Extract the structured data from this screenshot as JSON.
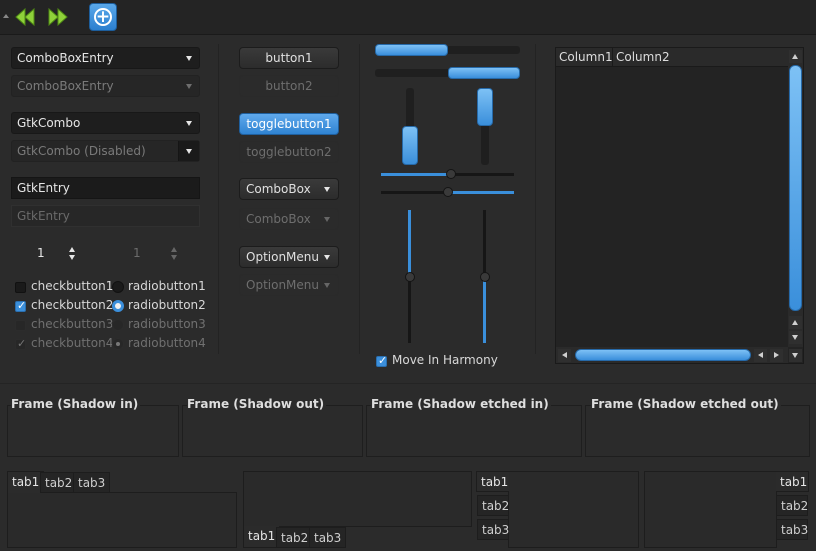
{
  "toolbar": {
    "icons": [
      "go-first-icon",
      "go-last-icon",
      "add-icon"
    ],
    "accent": "#3a8fdb"
  },
  "combos": {
    "entry": "ComboBoxEntry",
    "entry_disabled": "ComboBoxEntry",
    "gtkcombo": "GtkCombo",
    "gtkcombo_disabled": "GtkCombo (Disabled)"
  },
  "entries": {
    "entry": "GtkEntry",
    "entry_disabled": "GtkEntry"
  },
  "spins": {
    "spin": "1",
    "spin_disabled": "1"
  },
  "checks": [
    {
      "label": "checkbutton1",
      "state": "unchecked",
      "disabled": false
    },
    {
      "label": "checkbutton2",
      "state": "checked",
      "disabled": false
    },
    {
      "label": "checkbutton3",
      "state": "unchecked",
      "disabled": true
    },
    {
      "label": "checkbutton4",
      "state": "checked",
      "disabled": true
    }
  ],
  "radios": [
    {
      "label": "radiobutton1",
      "state": "unselected",
      "disabled": false
    },
    {
      "label": "radiobutton2",
      "state": "selected",
      "disabled": false
    },
    {
      "label": "radiobutton3",
      "state": "unselected",
      "disabled": true
    },
    {
      "label": "radiobutton4",
      "state": "selected",
      "disabled": true
    }
  ],
  "buttons": {
    "button1": "button1",
    "button2": "button2",
    "toggle1": "togglebutton1",
    "toggle2": "togglebutton2",
    "combobox": "ComboBox",
    "combobox_disabled": "ComboBox",
    "optionmenu": "OptionMenu",
    "optionmenu_disabled": "OptionMenu"
  },
  "move_in_harmony": {
    "label": "Move In Harmony",
    "checked": true
  },
  "tree": {
    "columns": [
      "Column1",
      "Column2"
    ]
  },
  "frames": [
    "Frame (Shadow in)",
    "Frame (Shadow out)",
    "Frame (Shadow etched in)",
    "Frame (Shadow etched out)"
  ],
  "notebooks": {
    "tabs": [
      "tab1",
      "tab2",
      "tab3"
    ]
  }
}
